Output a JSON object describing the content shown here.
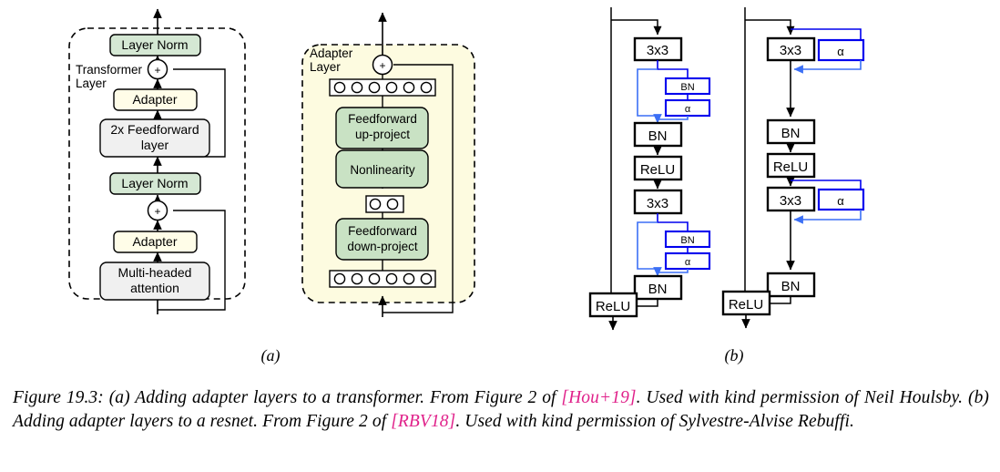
{
  "figure": {
    "caption": {
      "label": "Figure 19.3:",
      "part1": "(a) Adding adapter layers to a transformer. From Figure 2 of",
      "cite1": "[Hou+19]",
      "part2": ". Used with kind permission of Neil Houlsby. (b) Adding adapter layers to a resnet. From Figure 2 of",
      "cite2": "[RBV18]",
      "part3": ". Used with kind permission of Sylvestre-Alvise Rebuffi.",
      "cite_color": "#e0218a"
    },
    "subcaptions": {
      "a": "(a)",
      "b": "(b)"
    }
  },
  "panel_a": {
    "transformer": {
      "group_label_line1": "Transformer",
      "group_label_line2": "Layer",
      "blocks": [
        {
          "id": "layer-norm-top",
          "label": "Layer Norm",
          "fill": "#d5e8d4"
        },
        {
          "id": "add-top",
          "label": "+"
        },
        {
          "id": "adapter-top",
          "label": "Adapter",
          "fill": "#fffde8"
        },
        {
          "id": "feedforward",
          "label_line1": "2x Feedforward",
          "label_line2": "layer",
          "fill": "#f0f0f0"
        },
        {
          "id": "layer-norm-mid",
          "label": "Layer Norm",
          "fill": "#d5e8d4"
        },
        {
          "id": "add-bottom",
          "label": "+"
        },
        {
          "id": "adapter-bottom",
          "label": "Adapter",
          "fill": "#fffde8"
        },
        {
          "id": "attention",
          "label_line1": "Multi-headed",
          "label_line2": "attention",
          "fill": "#f0f0f0"
        }
      ]
    },
    "adapter": {
      "group_label_line1": "Adapter",
      "group_label_line2": "Layer",
      "group_fill": "#fdfbe0",
      "blocks": [
        {
          "id": "add",
          "label": "+"
        },
        {
          "id": "neurons-top",
          "label": "",
          "count": 6
        },
        {
          "id": "ff-up",
          "label_line1": "Feedforward",
          "label_line2": "up-project",
          "fill": "#c9e2c4"
        },
        {
          "id": "nonlinearity",
          "label": "Nonlinearity",
          "fill": "#c9e2c4"
        },
        {
          "id": "neurons-mid",
          "label": "",
          "count": 2
        },
        {
          "id": "ff-down",
          "label_line1": "Feedforward",
          "label_line2": "down-project",
          "fill": "#c9e2c4"
        },
        {
          "id": "neurons-bottom",
          "label": "",
          "count": 6
        }
      ]
    }
  },
  "panel_b": {
    "accent_color": "#0000ee",
    "left_column": {
      "blocks": [
        "3x3",
        "BN",
        "ReLU",
        "3x3",
        "BN",
        "ReLU"
      ],
      "adapter_blocks": [
        "BN",
        "α",
        "BN",
        "α"
      ]
    },
    "right_column": {
      "blocks": [
        "3x3",
        "BN",
        "ReLU",
        "3x3",
        "BN",
        "ReLU"
      ],
      "adapter_blocks": [
        "α",
        "α"
      ]
    }
  }
}
